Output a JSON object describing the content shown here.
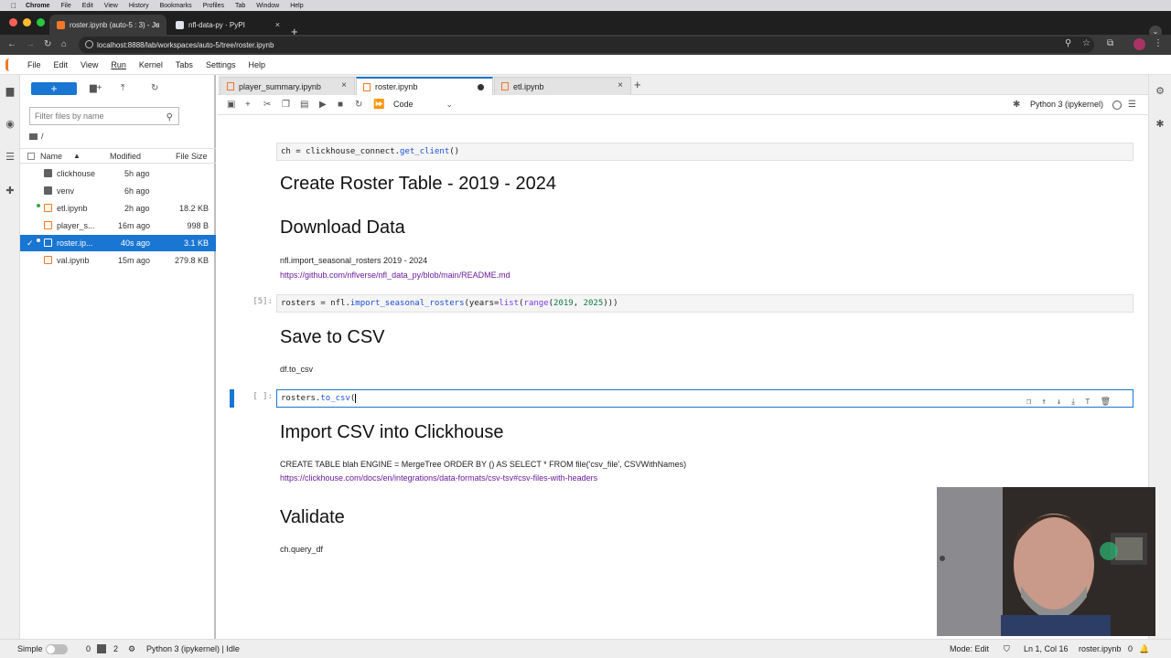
{
  "mac_menu": {
    "app": "Chrome",
    "items": [
      "File",
      "Edit",
      "View",
      "History",
      "Bookmarks",
      "Profiles",
      "Tab",
      "Window",
      "Help"
    ]
  },
  "browser": {
    "tabs": [
      {
        "title": "roster.ipynb (auto-5 : 3) - Ju",
        "active": true
      },
      {
        "title": "nfl-data-py · PyPI",
        "active": false
      }
    ],
    "url": "localhost:8888/lab/workspaces/auto-5/tree/roster.ipynb"
  },
  "jupyter": {
    "menu": [
      "File",
      "Edit",
      "View",
      "Run",
      "Kernel",
      "Tabs",
      "Settings",
      "Help"
    ],
    "filebrowser": {
      "filter_placeholder": "Filter files by name",
      "breadcrumb": "/",
      "columns": {
        "name": "Name",
        "modified": "Modified",
        "size": "File Size"
      },
      "files": [
        {
          "name": "clickhouse",
          "modified": "5h ago",
          "size": "",
          "type": "folder"
        },
        {
          "name": "venv",
          "modified": "6h ago",
          "size": "",
          "type": "folder"
        },
        {
          "name": "etl.ipynb",
          "modified": "2h ago",
          "size": "18.2 KB",
          "type": "notebook"
        },
        {
          "name": "player_s...",
          "modified": "16m ago",
          "size": "998 B",
          "type": "notebook"
        },
        {
          "name": "roster.ip...",
          "modified": "40s ago",
          "size": "3.1 KB",
          "type": "notebook"
        },
        {
          "name": "val.ipynb",
          "modified": "15m ago",
          "size": "279.8 KB",
          "type": "notebook"
        }
      ]
    },
    "notebook_tabs": [
      {
        "title": "player_summary.ipynb"
      },
      {
        "title": "roster.ipynb"
      },
      {
        "title": "etl.ipynb"
      }
    ],
    "toolbar": {
      "cell_type": "Code",
      "kernel": "Python 3 (ipykernel)"
    },
    "cells": {
      "c0_code": "ch = clickhouse_connect.get_client()",
      "h_create": "Create Roster Table - 2019 - 2024",
      "h_download": "Download Data",
      "p_import": "nfl.import_seasonal_rosters 2019 - 2024",
      "link_readme": "https://github.com/nflverse/nfl_data_py/blob/main/README.md",
      "prompt5": "[5]:",
      "h_save": "Save to CSV",
      "p_tocsv": "df.to_csv",
      "prompt_empty": "[ ]:",
      "h_import": "Import CSV into Clickhouse",
      "p_create": "CREATE TABLE blah ENGINE = MergeTree ORDER BY () AS SELECT * FROM file('csv_file', CSVWithNames)",
      "link_ch": "https://clickhouse.com/docs/en/integrations/data-formats/csv-tsv#csv-files-with-headers",
      "h_validate": "Validate",
      "p_query": "ch.query_df"
    },
    "status": {
      "mode_label": "Simple",
      "count_a": "0",
      "count_b": "2",
      "kernel_state": "Python 3 (ipykernel) | Idle",
      "mode": "Mode: Edit",
      "cursor": "Ln 1, Col 16",
      "file": "roster.ipynb",
      "notifications": "0"
    }
  },
  "colors": {
    "accent": "#1976d2",
    "jupyter_orange": "#f37726",
    "link": "#6a1b9a"
  }
}
